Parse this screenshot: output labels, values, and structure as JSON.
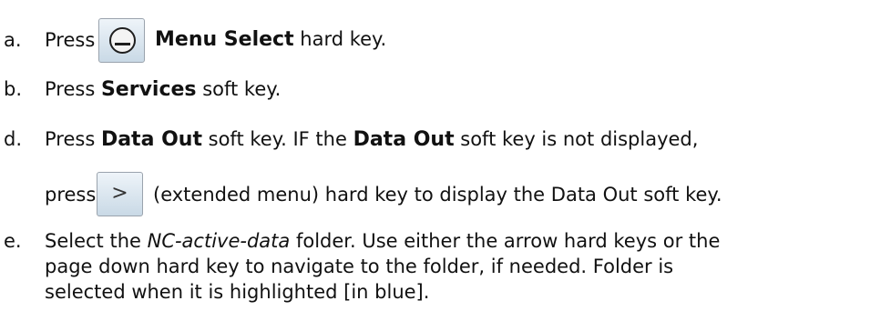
{
  "steps": [
    {
      "marker": "a.",
      "pre": "Press",
      "key_icon": "menu-select-key-icon",
      "bold": "Menu Select",
      "post": " hard key."
    },
    {
      "marker": "b.",
      "pre": "Press ",
      "bold": "Services",
      "post": " soft key."
    },
    {
      "marker": "d.",
      "pre": "Press ",
      "bold1": "Data Out",
      "mid": " soft key. IF the ",
      "bold2": "Data Out",
      "post": " soft key is not displayed,",
      "line2_pre": "press",
      "key_glyph": ">",
      "line2_post": "(extended menu) hard key to display the Data Out soft key."
    },
    {
      "marker": "e.",
      "pre": "Select the ",
      "italic": "NC-active-data",
      "line1_post": " folder. Use either the arrow hard keys or the",
      "line2": "page down hard key to navigate to the folder, if needed. Folder is",
      "line3": "selected when it is highlighted [in blue]."
    }
  ]
}
